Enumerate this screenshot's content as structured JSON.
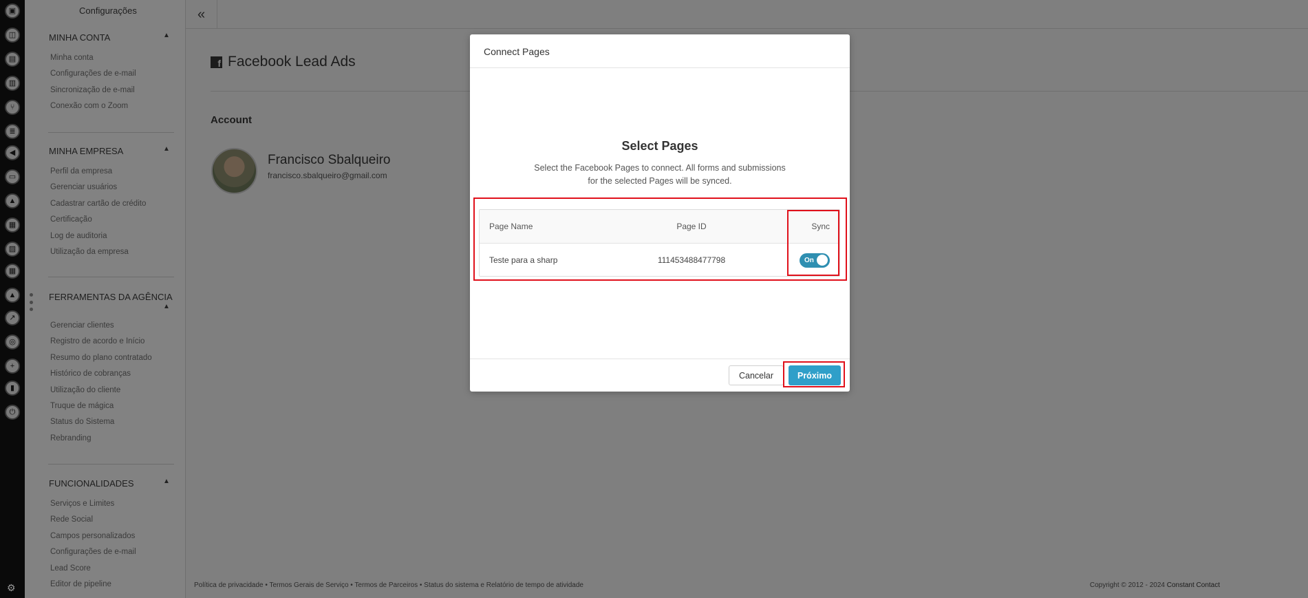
{
  "rail": {
    "icons": [
      "user-icon",
      "inbox-icon",
      "clipboard-icon",
      "map-icon",
      "branch-icon",
      "list-icon",
      "megaphone-icon",
      "chat-icon",
      "thumbs-up-icon",
      "video-icon",
      "image-icon",
      "calendar-icon",
      "graduation-icon",
      "trend-icon",
      "support-icon",
      "add-user-icon",
      "bar-chart-icon",
      "plug-icon"
    ],
    "gear_icon": "gear-icon"
  },
  "sidebar": {
    "title": "Configurações",
    "sections": [
      {
        "title": "MINHA CONTA",
        "items": [
          "Minha conta",
          "Configurações de e-mail",
          "Sincronização de e-mail",
          "Conexão com o Zoom"
        ]
      },
      {
        "title": "MINHA EMPRESA",
        "items": [
          "Perfil da empresa",
          "Gerenciar usuários",
          "Cadastrar cartão de crédito",
          "Certificação",
          "Log de auditoria",
          "Utilização da empresa"
        ]
      },
      {
        "title": "FERRAMENTAS DA AGÊNCIA",
        "items": [
          "Gerenciar clientes",
          "Registro de acordo e Início",
          "Resumo do plano contratado",
          "Histórico de cobranças",
          "Utilização do cliente",
          "Truque de mágica",
          "Status do Sistema",
          "Rebranding"
        ]
      },
      {
        "title": "FUNCIONALIDADES",
        "items": [
          "Serviços e Limites",
          "Rede Social",
          "Campos personalizados",
          "Configurações de e-mail",
          "Lead Score",
          "Editor de pipeline"
        ]
      }
    ]
  },
  "header": {
    "collapse_glyph": "«"
  },
  "page": {
    "title": "Facebook Lead Ads",
    "account_heading": "Account",
    "account_name": "Francisco Sbalqueiro",
    "account_email": "francisco.sbalqueiro@gmail.com"
  },
  "footer": {
    "links": "Política de privacidade • Termos Gerais de Serviço • Termos de Parceiros • Status do sistema e Relatório de tempo de atividade",
    "copyright": "Copyright © 2012 - 2024",
    "brand": "Constant Contact"
  },
  "modal": {
    "title": "Connect Pages",
    "heading": "Select Pages",
    "description_line1": "Select the Facebook Pages to connect. All forms and submissions",
    "description_line2": "for the selected Pages will be synced.",
    "columns": {
      "name": "Page Name",
      "id": "Page ID",
      "sync": "Sync"
    },
    "rows": [
      {
        "name": "Teste para a sharp",
        "id": "111453488477798",
        "sync": "On"
      }
    ],
    "cancel_label": "Cancelar",
    "next_label": "Próximo"
  }
}
